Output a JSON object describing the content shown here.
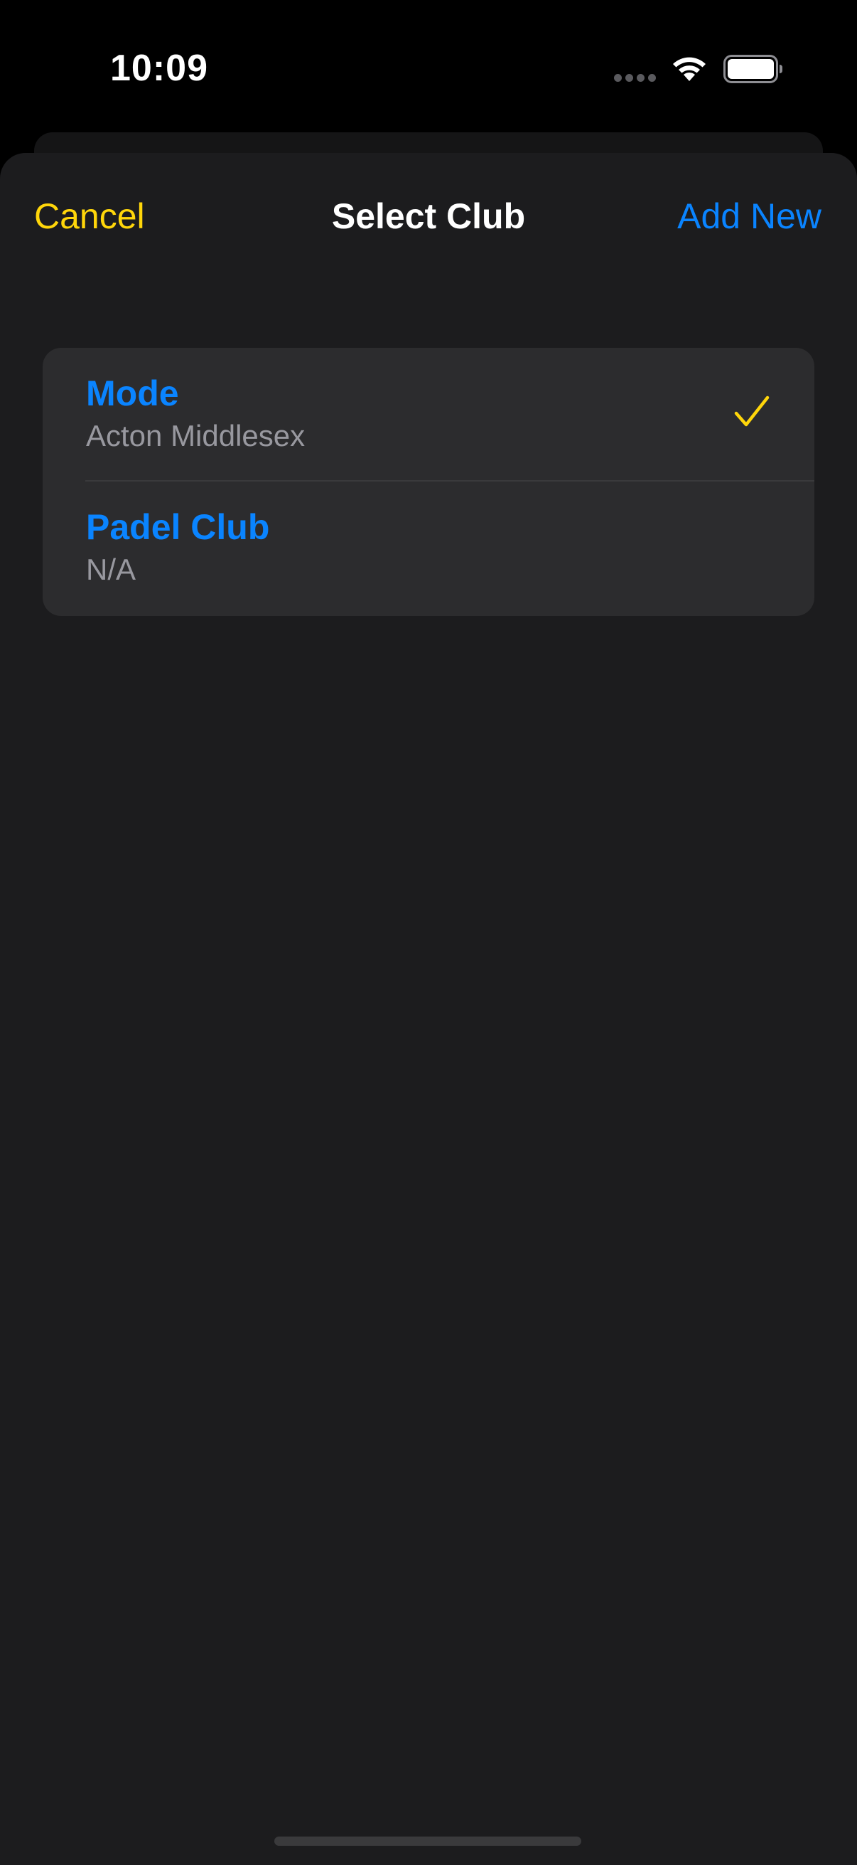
{
  "status_bar": {
    "time": "10:09",
    "icons": [
      "cellular-signal-icon",
      "wifi-icon",
      "battery-icon"
    ]
  },
  "sheet": {
    "title": "Select Club",
    "cancel_label": "Cancel",
    "add_new_label": "Add New",
    "colors": {
      "cancel": "#ffd60a",
      "accent": "#0a84ff",
      "checkmark": "#ffd60a",
      "background": "#1c1c1e",
      "row_background": "#2c2c2e"
    }
  },
  "clubs": [
    {
      "name": "Mode",
      "location": "Acton Middlesex",
      "selected": true,
      "icon": "checkmark-icon"
    },
    {
      "name": "Padel Club",
      "location": "N/A",
      "selected": false
    }
  ]
}
